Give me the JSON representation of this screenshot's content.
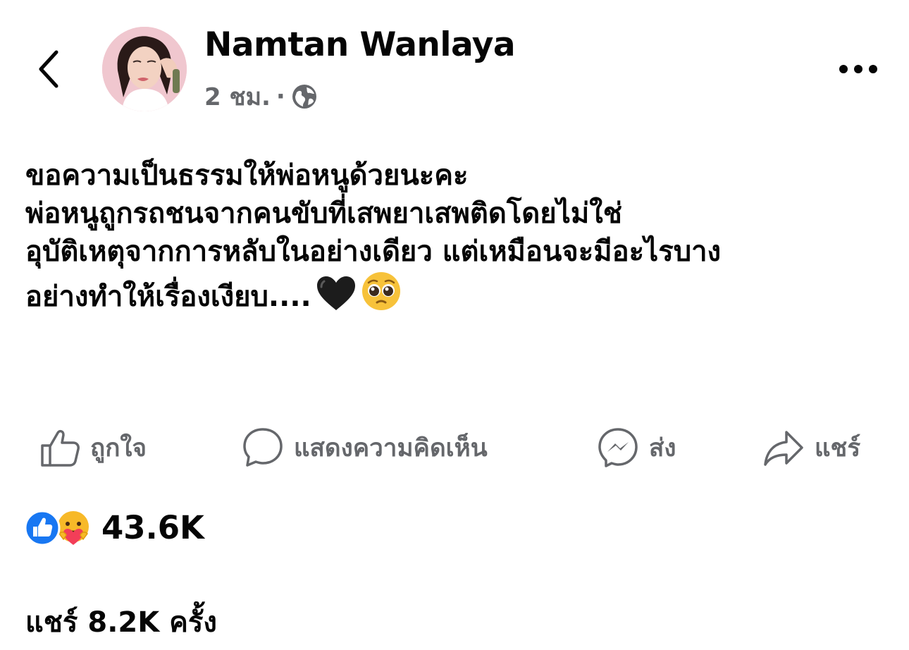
{
  "post": {
    "author": "Namtan Wanlaya",
    "time": "2 ชม.",
    "separator": "·",
    "lines": [
      "ขอความเป็นธรรมให้พ่อหนูด้วยนะคะ",
      "พ่อหนูถูกรถชนจากคนขับที่เสพยาเสพติดโดยไม่ใช่",
      "อุบัติเหตุจากการหลับในอย่างเดียว แต่เหมือนจะมีอะไรบาง",
      "อย่างทำให้เรื่องเงียบ...."
    ],
    "emojis": [
      "black-heart",
      "pleading-face"
    ]
  },
  "actions": {
    "like": "ถูกใจ",
    "comment": "แสดงความคิดเห็น",
    "send": "ส่ง",
    "share": "แชร์"
  },
  "engagement": {
    "reaction_icons": [
      "like-reaction",
      "care-reaction"
    ],
    "reaction_count": "43.6K",
    "shares_prefix": "แชร์",
    "shares_count": "8.2K",
    "shares_suffix": "ครั้ง"
  },
  "colors": {
    "text": "#050505",
    "secondary": "#65676b",
    "like_blue": "#1877f2",
    "care_yellow": "#f7b928"
  }
}
